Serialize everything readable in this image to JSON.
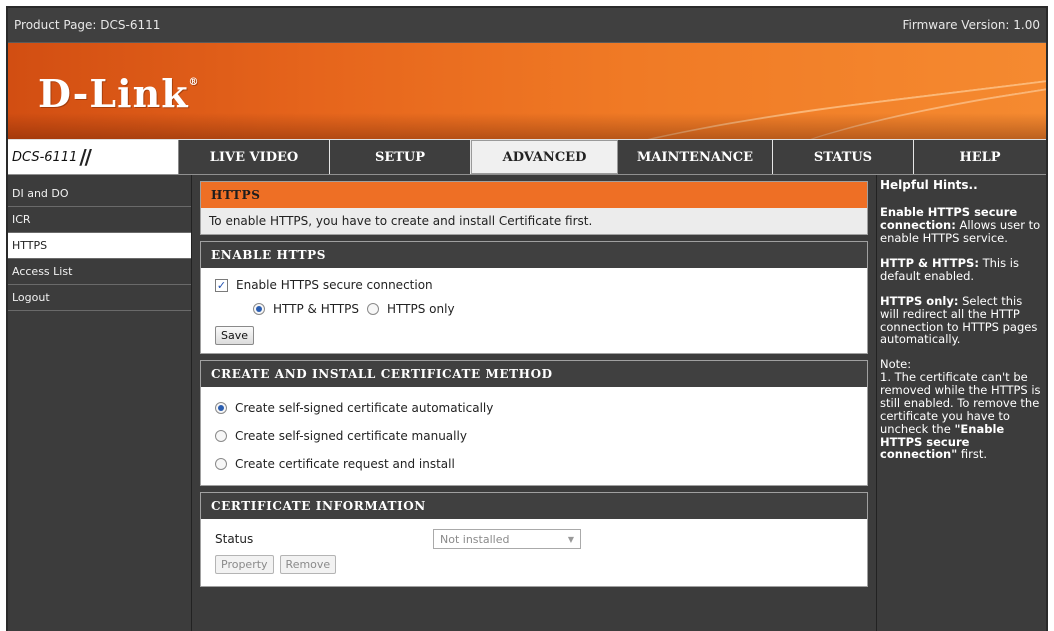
{
  "topbar": {
    "product": "Product Page: DCS-6111",
    "firmware": "Firmware Version: 1.00"
  },
  "brand": {
    "logo": "D-Link",
    "reg": "®"
  },
  "nav": {
    "model": "DCS-6111",
    "tabs": [
      {
        "label": "LIVE VIDEO",
        "active": false
      },
      {
        "label": "SETUP",
        "active": false
      },
      {
        "label": "ADVANCED",
        "active": true
      },
      {
        "label": "MAINTENANCE",
        "active": false
      },
      {
        "label": "STATUS",
        "active": false
      },
      {
        "label": "HELP",
        "active": false
      }
    ]
  },
  "sidebar": {
    "items": [
      {
        "label": "DI and DO"
      },
      {
        "label": "ICR"
      },
      {
        "label": "HTTPS",
        "active": true
      },
      {
        "label": "Access List"
      },
      {
        "label": "Logout"
      }
    ]
  },
  "https_section": {
    "title": "HTTPS",
    "intro": "To enable HTTPS, you have to create and install Certificate first."
  },
  "enable_section": {
    "title": "ENABLE HTTPS",
    "checkbox_label": "Enable HTTPS secure connection",
    "checkbox_checked": true,
    "radio_both": "HTTP & HTTPS",
    "radio_https": "HTTPS only",
    "selected": "both",
    "save": "Save"
  },
  "method_section": {
    "title": "CREATE AND INSTALL CERTIFICATE METHOD",
    "options": [
      "Create self-signed certificate automatically",
      "Create self-signed certificate manually",
      "Create certificate request and install"
    ],
    "selected_index": 0
  },
  "cert_section": {
    "title": "CERTIFICATE INFORMATION",
    "status_label": "Status",
    "status_value": "Not installed",
    "property": "Property",
    "remove": "Remove"
  },
  "hints": {
    "title": "Helpful Hints..",
    "h1_bold": "Enable HTTPS secure connection:",
    "h1_text": " Allows user to enable HTTPS service.",
    "h2_bold": "HTTP & HTTPS:",
    "h2_text": " This is default enabled.",
    "h3_bold": "HTTPS only:",
    "h3_text": " Select this will redirect all the HTTP connection to HTTPS pages automatically.",
    "note_label": "Note:",
    "note_text": "1. The certificate can't be removed while the HTTPS is still enabled. To remove the certificate you have to uncheck the ",
    "note_bold": "\"Enable HTTPS secure connection\"",
    "note_end": " first."
  },
  "colors": {
    "accent": "#ee6f25",
    "dark": "#3c3c3c"
  }
}
